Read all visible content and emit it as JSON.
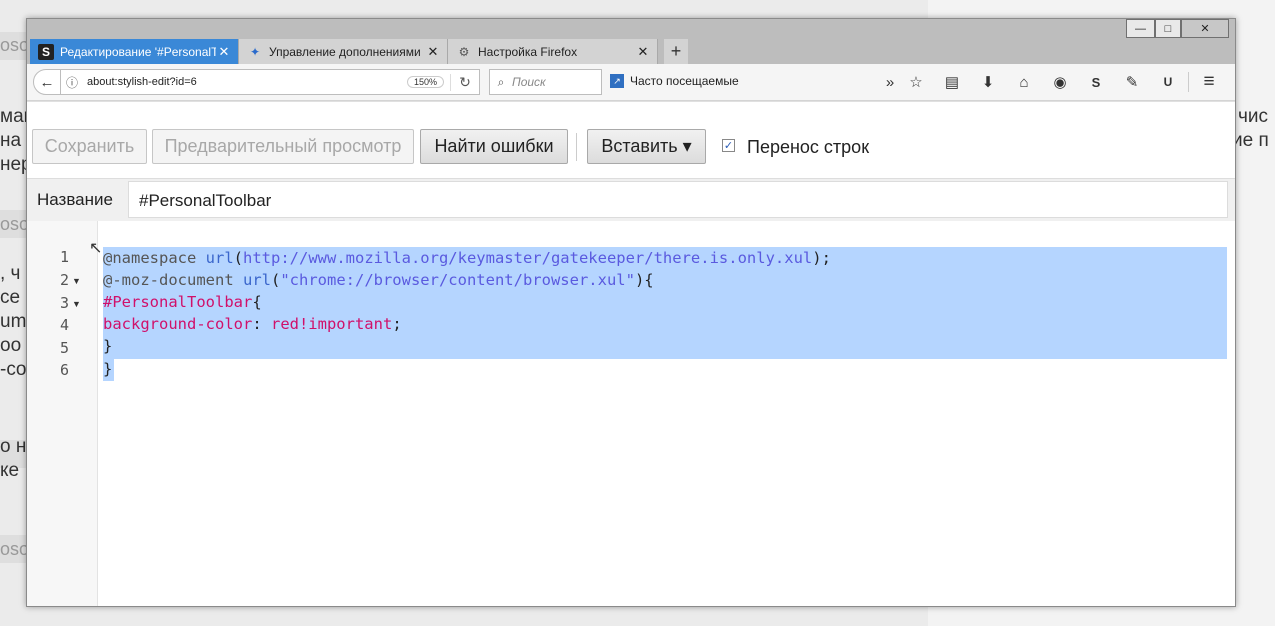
{
  "background": {
    "fragments": [
      "oso",
      "ман",
      "на",
      "нер",
      "oso",
      ", ч",
      "ce",
      "um",
      "oo",
      "-co",
      "о н",
      "ке",
      "oso",
      "oso",
      "чис",
      "ие п"
    ]
  },
  "window_controls": {
    "minimize": "—",
    "maximize": "□",
    "close": "✕"
  },
  "tabs": [
    {
      "label": "Редактирование '#PersonalT",
      "icon": "S",
      "close": "✕"
    },
    {
      "label": "Управление дополнениями",
      "icon": "✦",
      "close": "✕"
    },
    {
      "label": "Настройка Firefox",
      "icon": "⚙",
      "close": "✕"
    }
  ],
  "new_tab": "+",
  "nav": {
    "back": "←",
    "info": "ⓘ",
    "url": "about:stylish-edit?id=6",
    "zoom": "150%",
    "reload": "↻",
    "search_icon": "⌕",
    "search_placeholder": "Поиск",
    "bookmark_label": "Часто посещаемые",
    "bookmark_icon": "↗",
    "overflow": "»",
    "icons": [
      "☆",
      "▤",
      "⬇",
      "⌂",
      "◉",
      "S",
      "✎",
      "U",
      "≡"
    ]
  },
  "toolbar": {
    "save": "Сохранить",
    "preview": "Предварительный просмотр",
    "find_errors": "Найти ошибки",
    "insert": "Вставить ▾",
    "wrap_check": "✓",
    "wrap_label": "Перенос строк"
  },
  "name_field": {
    "label": "Название",
    "value": "#PersonalToolbar"
  },
  "editor": {
    "line_numbers": [
      "1",
      "2",
      "3",
      "4",
      "5",
      "6"
    ],
    "fold_markers": [
      "▼",
      "▼"
    ],
    "cursor": "↖",
    "line1": {
      "a": "@namespace ",
      "b": "url",
      "c": "(",
      "d": "http://www.mozilla.org/keymaster/gatekeeper/there.is.only.xul",
      "e": ");"
    },
    "line2": {
      "a": "@-moz-document ",
      "b": "url",
      "c": "(",
      "d": "\"chrome://browser/content/browser.xul\"",
      "e": "){"
    },
    "line3": {
      "a": "#PersonalToolbar",
      "b": "{"
    },
    "line4": {
      "a": "background-color",
      "b": ": ",
      "c": "red!important",
      "d": ";"
    },
    "line5": "}",
    "line6": "}"
  }
}
